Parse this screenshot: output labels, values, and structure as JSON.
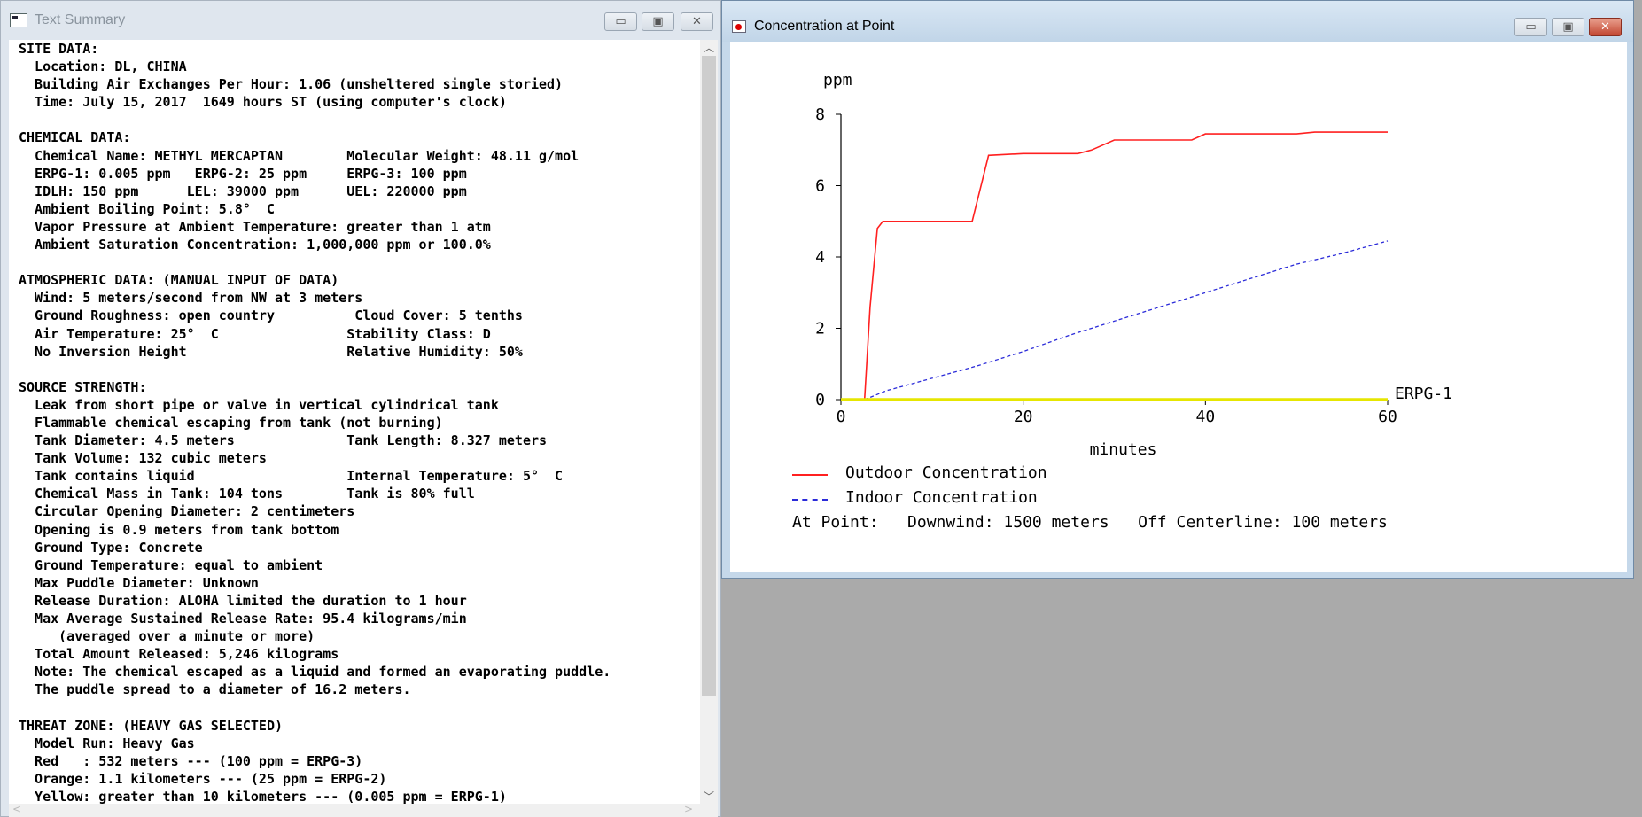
{
  "text_window": {
    "title": "Text Summary",
    "lines": [
      "SITE DATA:",
      "  Location: DL, CHINA",
      "  Building Air Exchanges Per Hour: 1.06 (unsheltered single storied)",
      "  Time: July 15, 2017  1649 hours ST (using computer's clock)",
      "",
      "CHEMICAL DATA:",
      "  Chemical Name: METHYL MERCAPTAN        Molecular Weight: 48.11 g/mol",
      "  ERPG-1: 0.005 ppm   ERPG-2: 25 ppm     ERPG-3: 100 ppm",
      "  IDLH: 150 ppm      LEL: 39000 ppm      UEL: 220000 ppm",
      "  Ambient Boiling Point: 5.8°  C",
      "  Vapor Pressure at Ambient Temperature: greater than 1 atm",
      "  Ambient Saturation Concentration: 1,000,000 ppm or 100.0%",
      "",
      "ATMOSPHERIC DATA: (MANUAL INPUT OF DATA)",
      "  Wind: 5 meters/second from NW at 3 meters",
      "  Ground Roughness: open country          Cloud Cover: 5 tenths",
      "  Air Temperature: 25°  C                Stability Class: D",
      "  No Inversion Height                    Relative Humidity: 50%",
      "",
      "SOURCE STRENGTH:",
      "  Leak from short pipe or valve in vertical cylindrical tank",
      "  Flammable chemical escaping from tank (not burning)",
      "  Tank Diameter: 4.5 meters              Tank Length: 8.327 meters",
      "  Tank Volume: 132 cubic meters",
      "  Tank contains liquid                   Internal Temperature: 5°  C",
      "  Chemical Mass in Tank: 104 tons        Tank is 80% full",
      "  Circular Opening Diameter: 2 centimeters",
      "  Opening is 0.9 meters from tank bottom",
      "  Ground Type: Concrete",
      "  Ground Temperature: equal to ambient",
      "  Max Puddle Diameter: Unknown",
      "  Release Duration: ALOHA limited the duration to 1 hour",
      "  Max Average Sustained Release Rate: 95.4 kilograms/min",
      "     (averaged over a minute or more)",
      "  Total Amount Released: 5,246 kilograms",
      "  Note: The chemical escaped as a liquid and formed an evaporating puddle.",
      "  The puddle spread to a diameter of 16.2 meters.",
      "",
      "THREAT ZONE: (HEAVY GAS SELECTED)",
      "  Model Run: Heavy Gas",
      "  Red   : 532 meters --- (100 ppm = ERPG-3)",
      "  Orange: 1.1 kilometers --- (25 ppm = ERPG-2)",
      "  Yellow: greater than 10 kilometers --- (0.005 ppm = ERPG-1)"
    ]
  },
  "chart_window": {
    "title": "Concentration at Point",
    "at_point": "At Point:   Downwind: 1500 meters   Off Centerline: 100 meters"
  },
  "colors": {
    "outdoor": "#ff2020",
    "indoor": "#2b2bd9",
    "erpg1": "#e6e600"
  },
  "chart_data": {
    "type": "line",
    "ylabel": "ppm",
    "xlabel": "minutes",
    "xlim": [
      0,
      60
    ],
    "ylim": [
      0,
      8
    ],
    "x_ticks": [
      0,
      20,
      40,
      60
    ],
    "y_ticks": [
      0,
      2,
      4,
      6,
      8
    ],
    "series": [
      {
        "name": "Outdoor Concentration",
        "style": "solid",
        "x": [
          2.6,
          3.2,
          4.0,
          4.6,
          10,
          14.4,
          16.2,
          20,
          26,
          27.5,
          30,
          36,
          38.5,
          40,
          50,
          52,
          60
        ],
        "y": [
          0,
          2.6,
          4.8,
          5.0,
          5.0,
          5.0,
          6.85,
          6.9,
          6.9,
          7.0,
          7.28,
          7.28,
          7.28,
          7.45,
          7.45,
          7.5,
          7.5
        ]
      },
      {
        "name": "Indoor Concentration",
        "style": "dashed",
        "x": [
          2.6,
          5,
          10,
          15,
          20,
          25,
          30,
          35,
          40,
          45,
          50,
          55,
          60
        ],
        "y": [
          0,
          0.25,
          0.6,
          0.95,
          1.35,
          1.8,
          2.2,
          2.6,
          3.0,
          3.4,
          3.8,
          4.1,
          4.45
        ]
      },
      {
        "name": "ERPG-1",
        "style": "solid",
        "x": [
          0,
          60
        ],
        "y": [
          0.005,
          0.005
        ]
      }
    ],
    "line_label": "ERPG-1"
  }
}
